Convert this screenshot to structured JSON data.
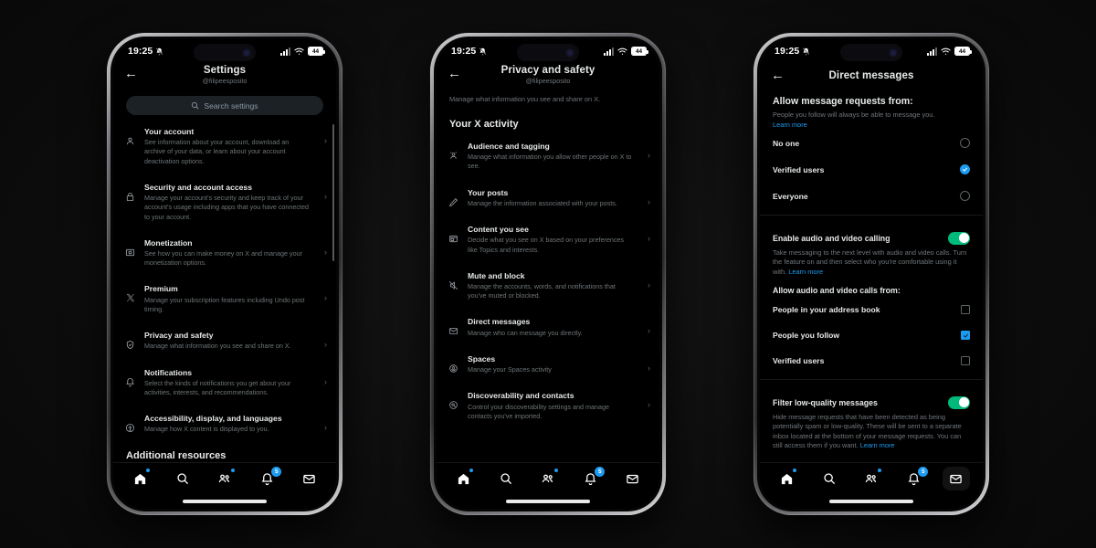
{
  "status_bar": {
    "time": "19:25",
    "mute_icon": "bell-slash-icon",
    "battery": "44"
  },
  "account": {
    "handle": "@filipeesposito"
  },
  "colors": {
    "accent": "#1d9bf0",
    "toggle_on": "#00ba7c",
    "text": "#e7e9ea",
    "muted": "#71767b",
    "bg": "#000000"
  },
  "nav": {
    "items": [
      {
        "name": "home",
        "icon": "home-icon",
        "dot": true,
        "badge": ""
      },
      {
        "name": "search",
        "icon": "search-icon",
        "dot": false,
        "badge": ""
      },
      {
        "name": "communities",
        "icon": "communities-icon",
        "dot": true,
        "badge": ""
      },
      {
        "name": "notifications",
        "icon": "bell-icon",
        "dot": false,
        "badge": "5"
      },
      {
        "name": "messages",
        "icon": "envelope-icon",
        "dot": false,
        "badge": ""
      }
    ]
  },
  "phone1": {
    "title": "Settings",
    "subtitle": "@filipeesposito",
    "search": {
      "placeholder": "Search settings",
      "icon": "search-icon"
    },
    "items": [
      {
        "icon": "person-icon",
        "title": "Your account",
        "desc": "See information about your account, download an archive of your data, or learn about your account deactivation options."
      },
      {
        "icon": "lock-icon",
        "title": "Security and account access",
        "desc": "Manage your account's security and keep track of your account's usage including apps that you have connected to your account."
      },
      {
        "icon": "monetization-icon",
        "title": "Monetization",
        "desc": "See how you can make money on X and manage your monetization options."
      },
      {
        "icon": "x-logo-icon",
        "title": "Premium",
        "desc": "Manage your subscription features including Undo post timing."
      },
      {
        "icon": "shield-check-icon",
        "title": "Privacy and safety",
        "desc": "Manage what information you see and share on X."
      },
      {
        "icon": "bell-icon",
        "title": "Notifications",
        "desc": "Select the kinds of notifications you get about your activities, interests, and recommendations."
      },
      {
        "icon": "accessibility-icon",
        "title": "Accessibility, display, and languages",
        "desc": "Manage how X content is displayed to you."
      }
    ],
    "footer_section": "Additional resources"
  },
  "phone2": {
    "title": "Privacy and safety",
    "subtitle": "@filipeesposito",
    "description": "Manage what information you see and share on X.",
    "section_title": "Your X activity",
    "items": [
      {
        "icon": "audience-icon",
        "title": "Audience and tagging",
        "desc": "Manage what information you allow other people on X to see."
      },
      {
        "icon": "pencil-icon",
        "title": "Your posts",
        "desc": "Manage the information associated with your posts."
      },
      {
        "icon": "content-icon",
        "title": "Content you see",
        "desc": "Decide what you see on X based on your preferences like Topics and interests."
      },
      {
        "icon": "mute-icon",
        "title": "Mute and block",
        "desc": "Manage the accounts, words, and notifications that you've muted or blocked."
      },
      {
        "icon": "envelope-icon",
        "title": "Direct messages",
        "desc": "Manage who can message you directly."
      },
      {
        "icon": "spaces-icon",
        "title": "Spaces",
        "desc": "Manage your Spaces activity"
      },
      {
        "icon": "discoverability-icon",
        "title": "Discoverability and contacts",
        "desc": "Control your discoverability settings and manage contacts you've imported."
      }
    ]
  },
  "phone3": {
    "title": "Direct messages",
    "requests": {
      "heading": "Allow message requests from:",
      "description": "People you follow will always be able to message you.",
      "link": "Learn more",
      "options": [
        {
          "label": "No one",
          "selected": false
        },
        {
          "label": "Verified users",
          "selected": true
        },
        {
          "label": "Everyone",
          "selected": false
        }
      ]
    },
    "calling": {
      "label": "Enable audio and video calling",
      "enabled": true,
      "description": "Take messaging to the next level with audio and video calls. Turn the feature on and then select who you're comfortable using it with.",
      "link": "Learn more",
      "sub_heading": "Allow audio and video calls from:",
      "checkboxes": [
        {
          "label": "People in your address book",
          "checked": false
        },
        {
          "label": "People you follow",
          "checked": true
        },
        {
          "label": "Verified users",
          "checked": false
        }
      ]
    },
    "filter": {
      "label": "Filter low-quality messages",
      "enabled": true,
      "description": "Hide message requests that have been detected as being potentially spam or low-quality. These will be sent to a separate inbox located at the bottom of your message requests. You can still access them if you want.",
      "link": "Learn more"
    }
  }
}
